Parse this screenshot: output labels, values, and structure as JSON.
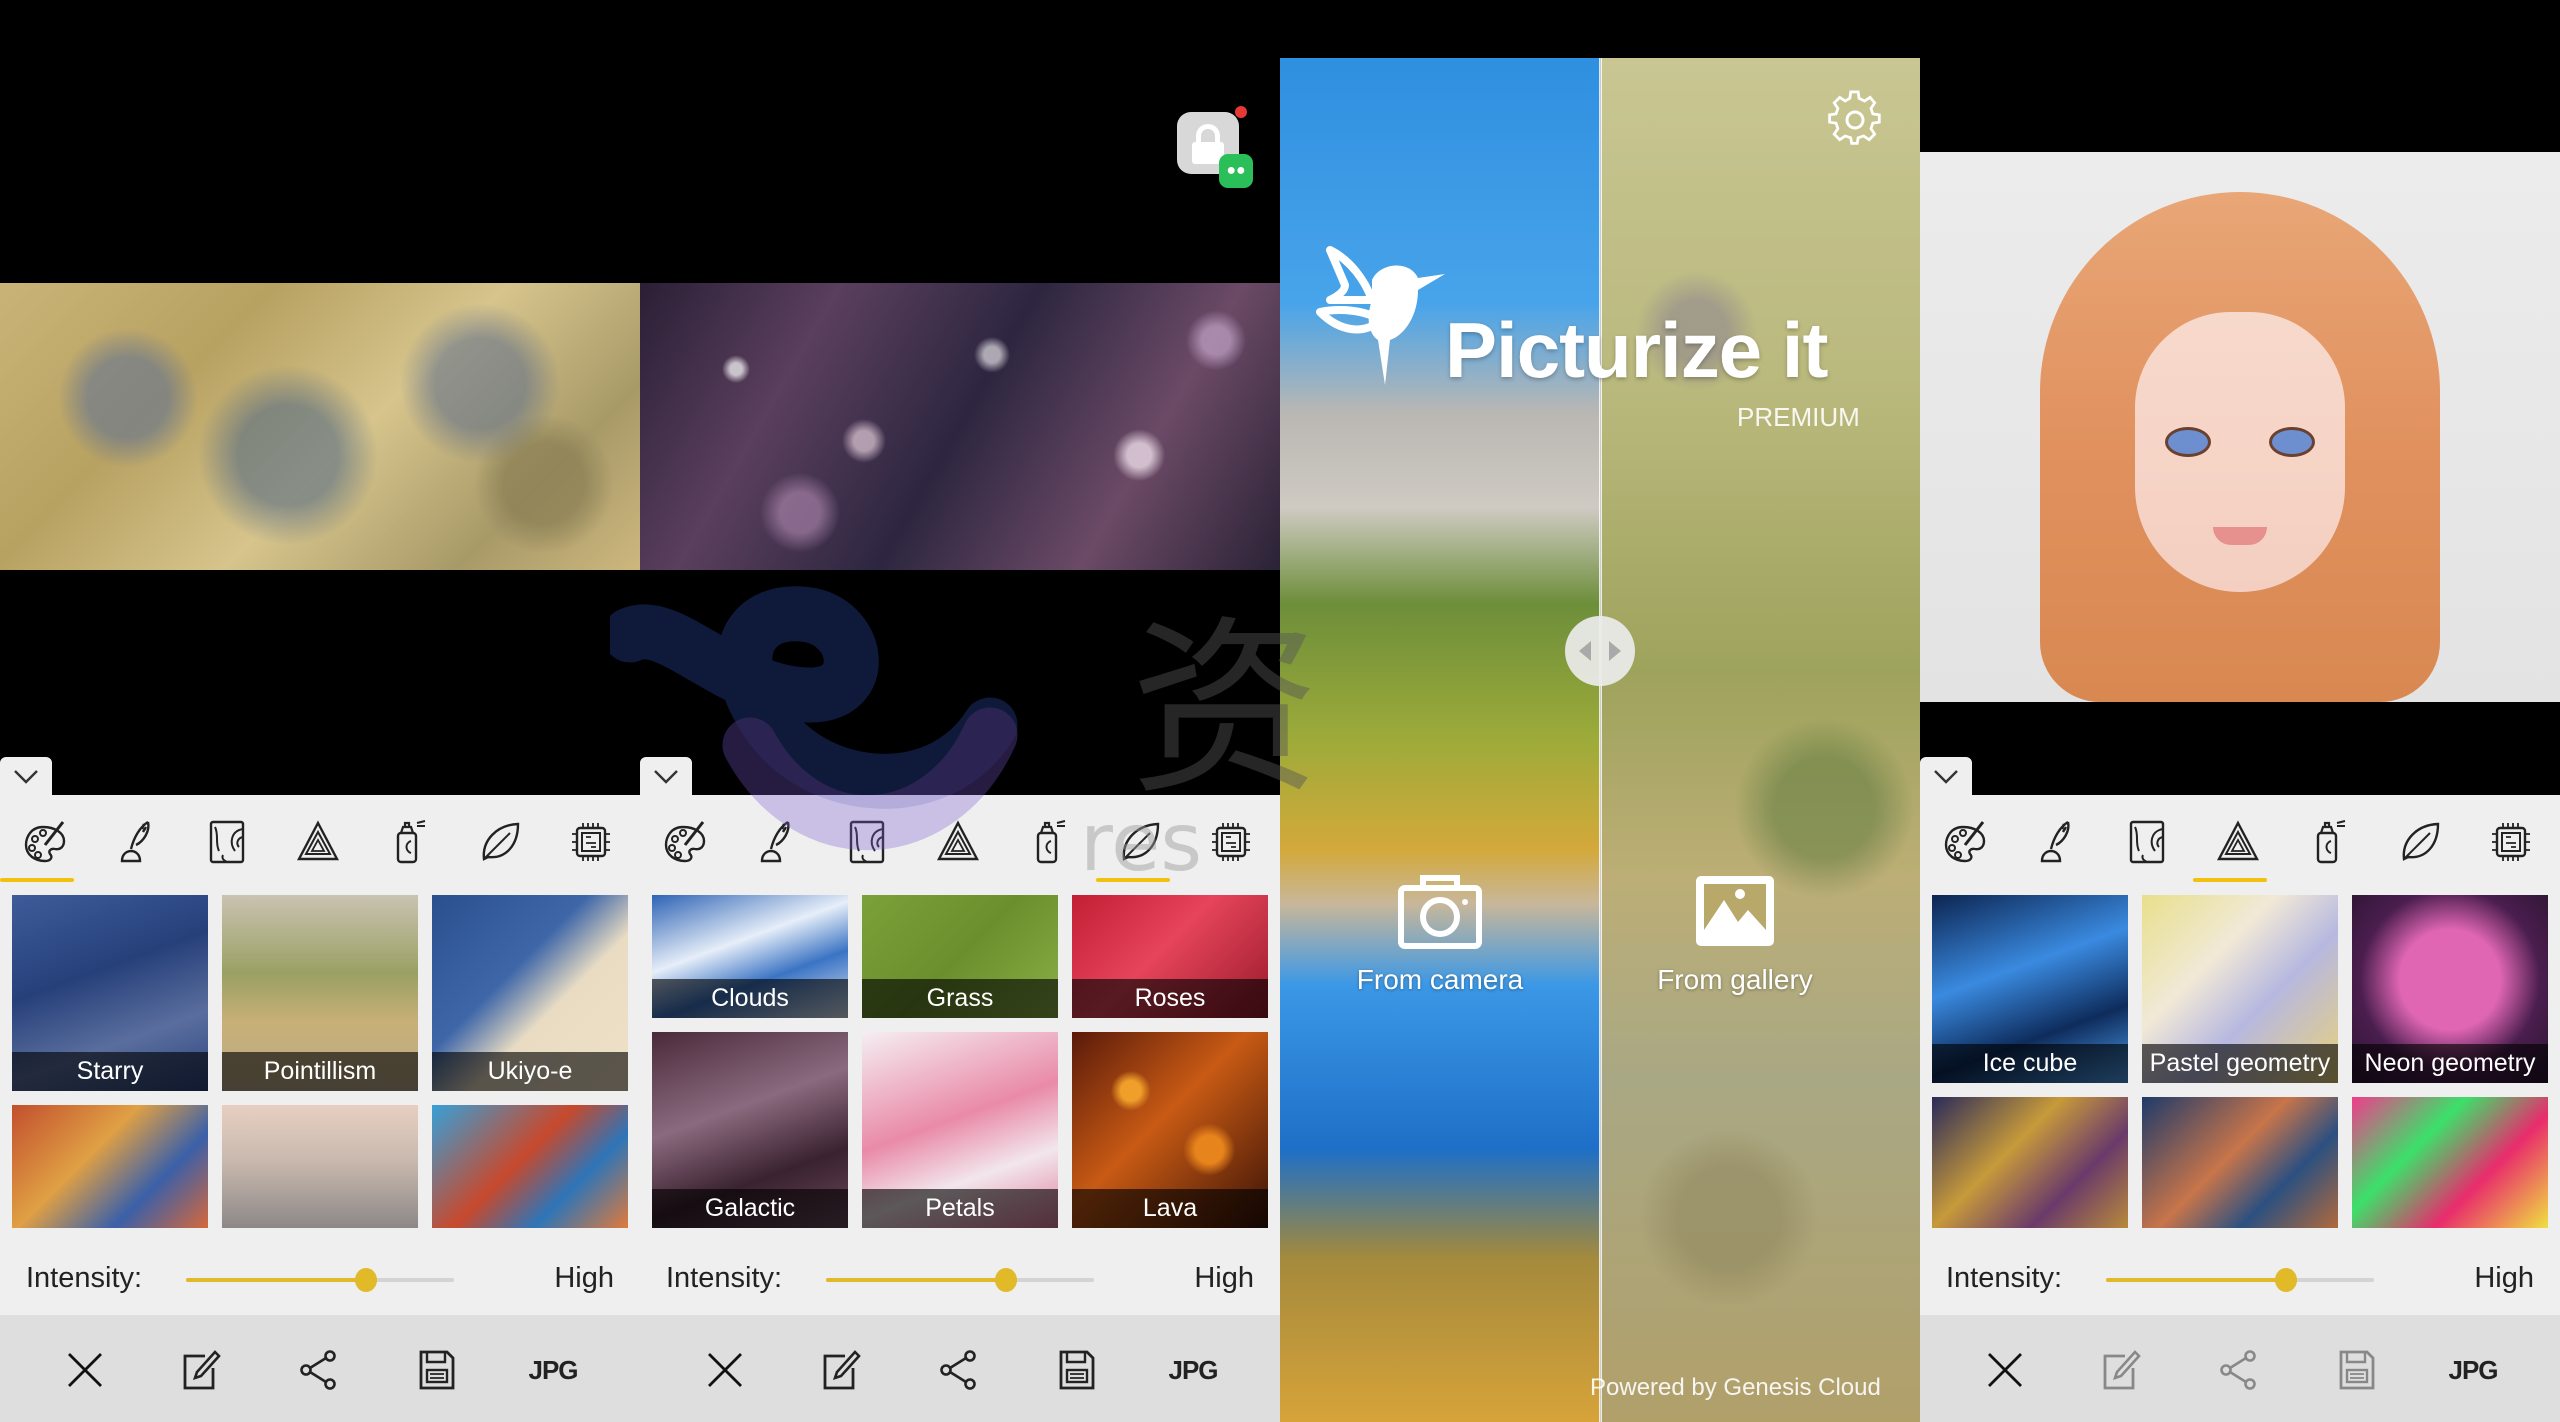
{
  "colors": {
    "accent": "#f1c10f",
    "slider_fill": "#e2b928",
    "sheet_bg": "#efefef",
    "bottombar_bg": "#dedede",
    "disabled_icon": "#8f8f8f"
  },
  "style_categories": [
    {
      "icon": "palette-icon",
      "label": "Art"
    },
    {
      "icon": "quill-ink-icon",
      "label": "Sketch"
    },
    {
      "icon": "wood-grain-icon",
      "label": "Texture"
    },
    {
      "icon": "penrose-triangle-icon",
      "label": "Geometry"
    },
    {
      "icon": "spray-can-icon",
      "label": "Street"
    },
    {
      "icon": "leaf-icon",
      "label": "Nature"
    },
    {
      "icon": "chip-icon",
      "label": "Tech"
    }
  ],
  "panels": [
    {
      "active_tab_index": 0,
      "styles": [
        "Starry",
        "Pointillism",
        "Ukiyo-e",
        "",
        "",
        ""
      ],
      "intensity": {
        "label": "Intensity:",
        "value_label": "High",
        "value_percent": 67
      },
      "bottom_bar": {
        "close": "close-icon",
        "edit": "edit-icon",
        "share": "share-icon",
        "save": "save-icon",
        "format": "JPG",
        "disabled": false
      }
    },
    {
      "active_tab_index": 5,
      "styles": [
        "Clouds",
        "Grass",
        "Roses",
        "Galactic",
        "Petals",
        "Lava"
      ],
      "intensity": {
        "label": "Intensity:",
        "value_label": "High",
        "value_percent": 67
      },
      "bottom_bar": {
        "close": "close-icon",
        "edit": "edit-icon",
        "share": "share-icon",
        "save": "save-icon",
        "format": "JPG",
        "disabled": false
      }
    },
    {
      "active_tab_index": 3,
      "styles": [
        "Ice cube",
        "Pastel geometry",
        "Neon geometry",
        "",
        "",
        ""
      ],
      "intensity": {
        "label": "Intensity:",
        "value_label": "High",
        "value_percent": 67
      },
      "bottom_bar": {
        "close": "close-icon",
        "edit": "edit-icon",
        "share": "share-icon",
        "save": "save-icon",
        "format": "JPG",
        "disabled": true
      }
    }
  ],
  "home": {
    "app_name": "Picturize it",
    "tier": "PREMIUM",
    "from_camera": "From camera",
    "from_gallery": "From gallery",
    "powered_by": "Powered by Genesis Cloud"
  },
  "watermark": {
    "glyph": "资",
    "text": "res"
  }
}
